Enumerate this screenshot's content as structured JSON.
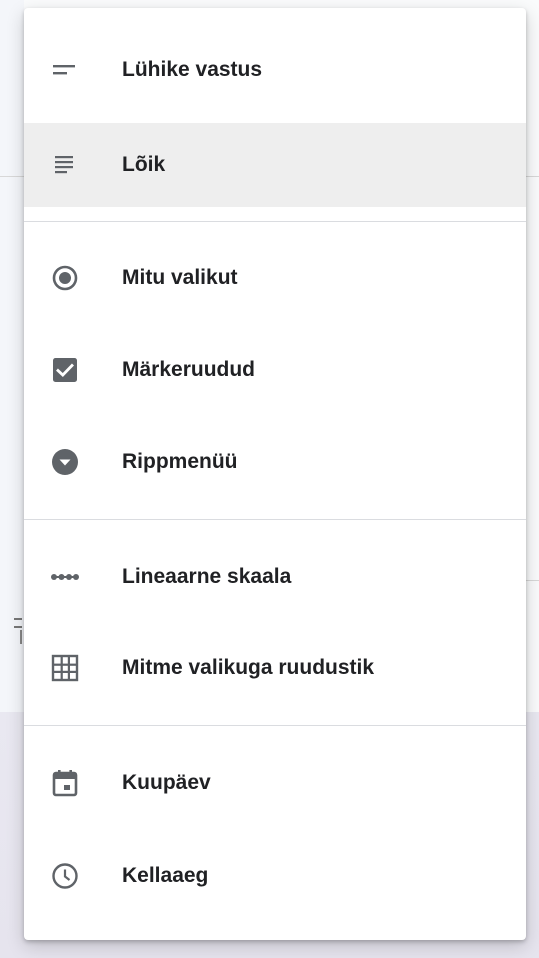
{
  "menu": {
    "items": [
      {
        "label": "Lühike vastus",
        "icon": "short-answer-icon",
        "selected": false
      },
      {
        "label": "Lõik",
        "icon": "paragraph-icon",
        "selected": true
      },
      {
        "label": "Mitu valikut",
        "icon": "radio-button-icon",
        "selected": false
      },
      {
        "label": "Märkeruudud",
        "icon": "checkbox-icon",
        "selected": false
      },
      {
        "label": "Rippmenüü",
        "icon": "dropdown-circle-icon",
        "selected": false
      },
      {
        "label": "Lineaarne skaala",
        "icon": "linear-scale-icon",
        "selected": false
      },
      {
        "label": "Mitme valikuga ruudustik",
        "icon": "grid-icon",
        "selected": false
      },
      {
        "label": "Kuupäev",
        "icon": "calendar-icon",
        "selected": false
      },
      {
        "label": "Kellaaeg",
        "icon": "clock-icon",
        "selected": false
      }
    ]
  },
  "colors": {
    "icon": "#5f6368",
    "text": "#202124",
    "selected_bg": "#eeeeee",
    "divider": "#dadce0"
  }
}
